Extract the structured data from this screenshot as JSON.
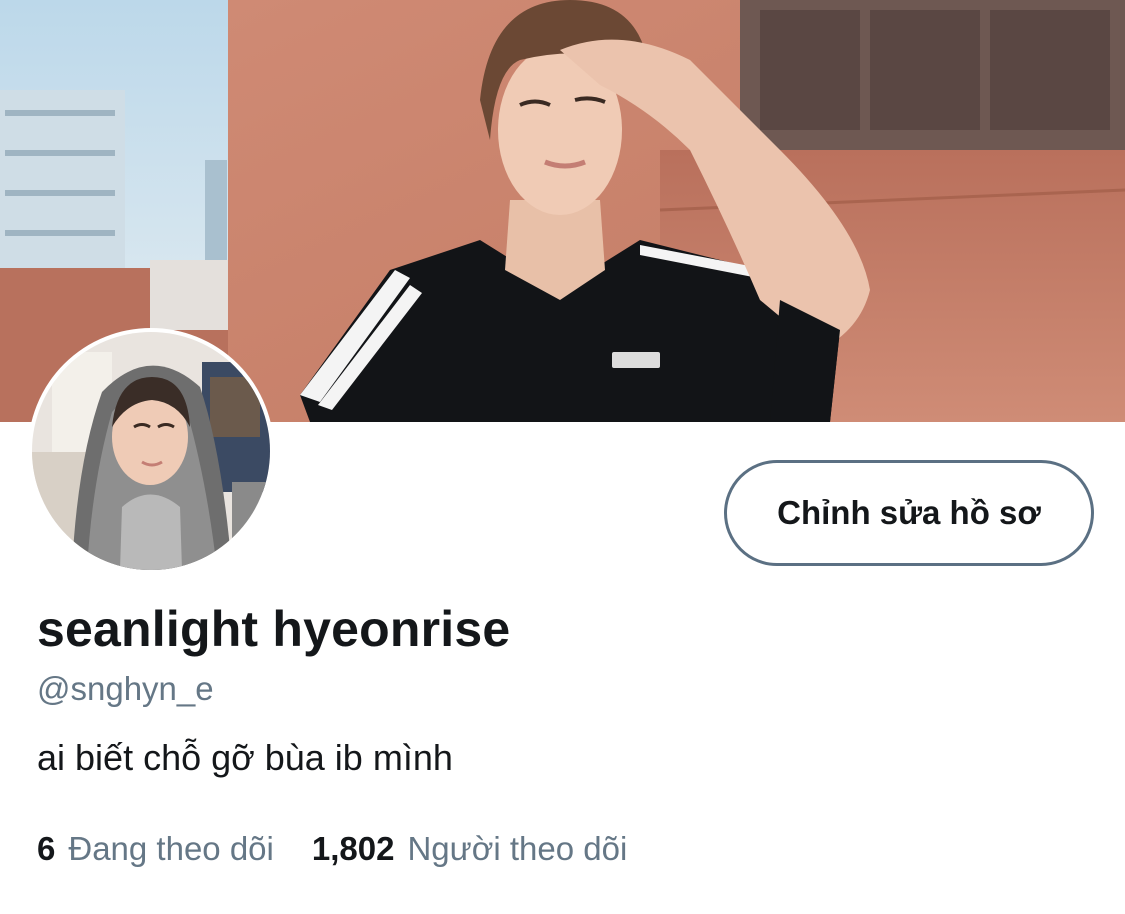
{
  "profile": {
    "display_name": "seanlight hyeonrise",
    "handle": "@snghyn_e",
    "bio": "ai biết chỗ gỡ bùa ib mình",
    "edit_button_label": "Chỉnh sửa hồ sơ"
  },
  "stats": {
    "following_count": "6",
    "following_label": "Đang theo dõi",
    "followers_count": "1,802",
    "followers_label": "Người theo dõi"
  },
  "images": {
    "banner": "header-photo",
    "avatar": "profile-photo"
  },
  "colors": {
    "text_primary": "#14171a",
    "text_secondary": "#657786",
    "button_border": "#5b7083",
    "background": "#ffffff"
  }
}
